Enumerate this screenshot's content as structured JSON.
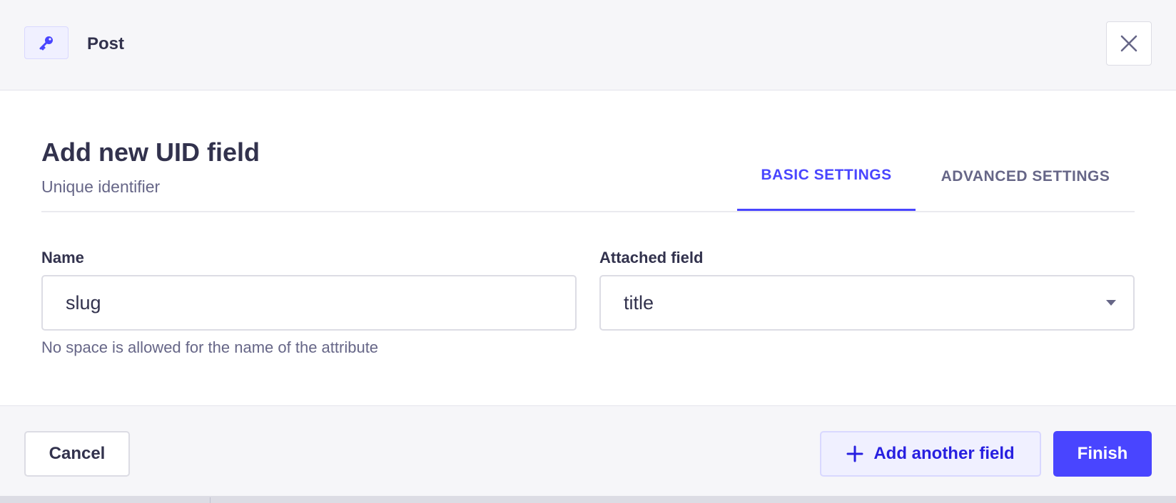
{
  "header": {
    "icon": "key-icon",
    "title": "Post",
    "close_icon": "close-icon"
  },
  "form": {
    "title": "Add new UID field",
    "subtitle": "Unique identifier",
    "tabs": [
      {
        "label": "BASIC SETTINGS",
        "active": true
      },
      {
        "label": "ADVANCED SETTINGS",
        "active": false
      }
    ],
    "name_field": {
      "label": "Name",
      "value": "slug",
      "hint": "No space is allowed for the name of the attribute"
    },
    "attached_field": {
      "label": "Attached field",
      "value": "title",
      "caret_icon": "caret-down-icon"
    }
  },
  "footer": {
    "cancel_label": "Cancel",
    "add_label": "Add another field",
    "add_icon": "plus-icon",
    "finish_label": "Finish"
  },
  "colors": {
    "primary": "#4945ff",
    "primary_dark": "#271fe0",
    "primary_light": "#f0f0ff",
    "text": "#32324d",
    "muted": "#666687",
    "border": "#dcdce4",
    "background": "#f6f6f9"
  }
}
